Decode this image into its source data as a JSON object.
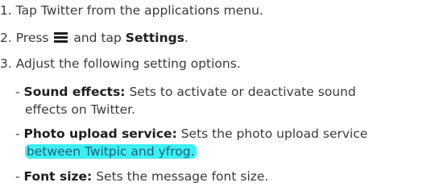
{
  "steps": [
    {
      "text": "1. Tap Twitter from the applications menu."
    },
    {
      "prefix": "2. Press ",
      "mid": " and tap ",
      "bold": "Settings",
      "suffix": "."
    },
    {
      "text": "3. Adjust the following setting options."
    }
  ],
  "options": [
    {
      "dash": "- ",
      "title": "Sound effects:",
      "desc_line1": " Sets to activate or deactivate sound",
      "desc_line2": "effects on Twitter."
    },
    {
      "dash": "- ",
      "title": "Photo upload service:",
      "desc_line1": " Sets the photo upload service",
      "desc_line2": "between Twitpic and yfrog."
    },
    {
      "dash": "- ",
      "title": "Font size:",
      "desc_line1": " Sets the message font size."
    }
  ],
  "icons": {
    "menu": "menu-icon"
  },
  "colors": {
    "highlight": "#3df0f0"
  }
}
